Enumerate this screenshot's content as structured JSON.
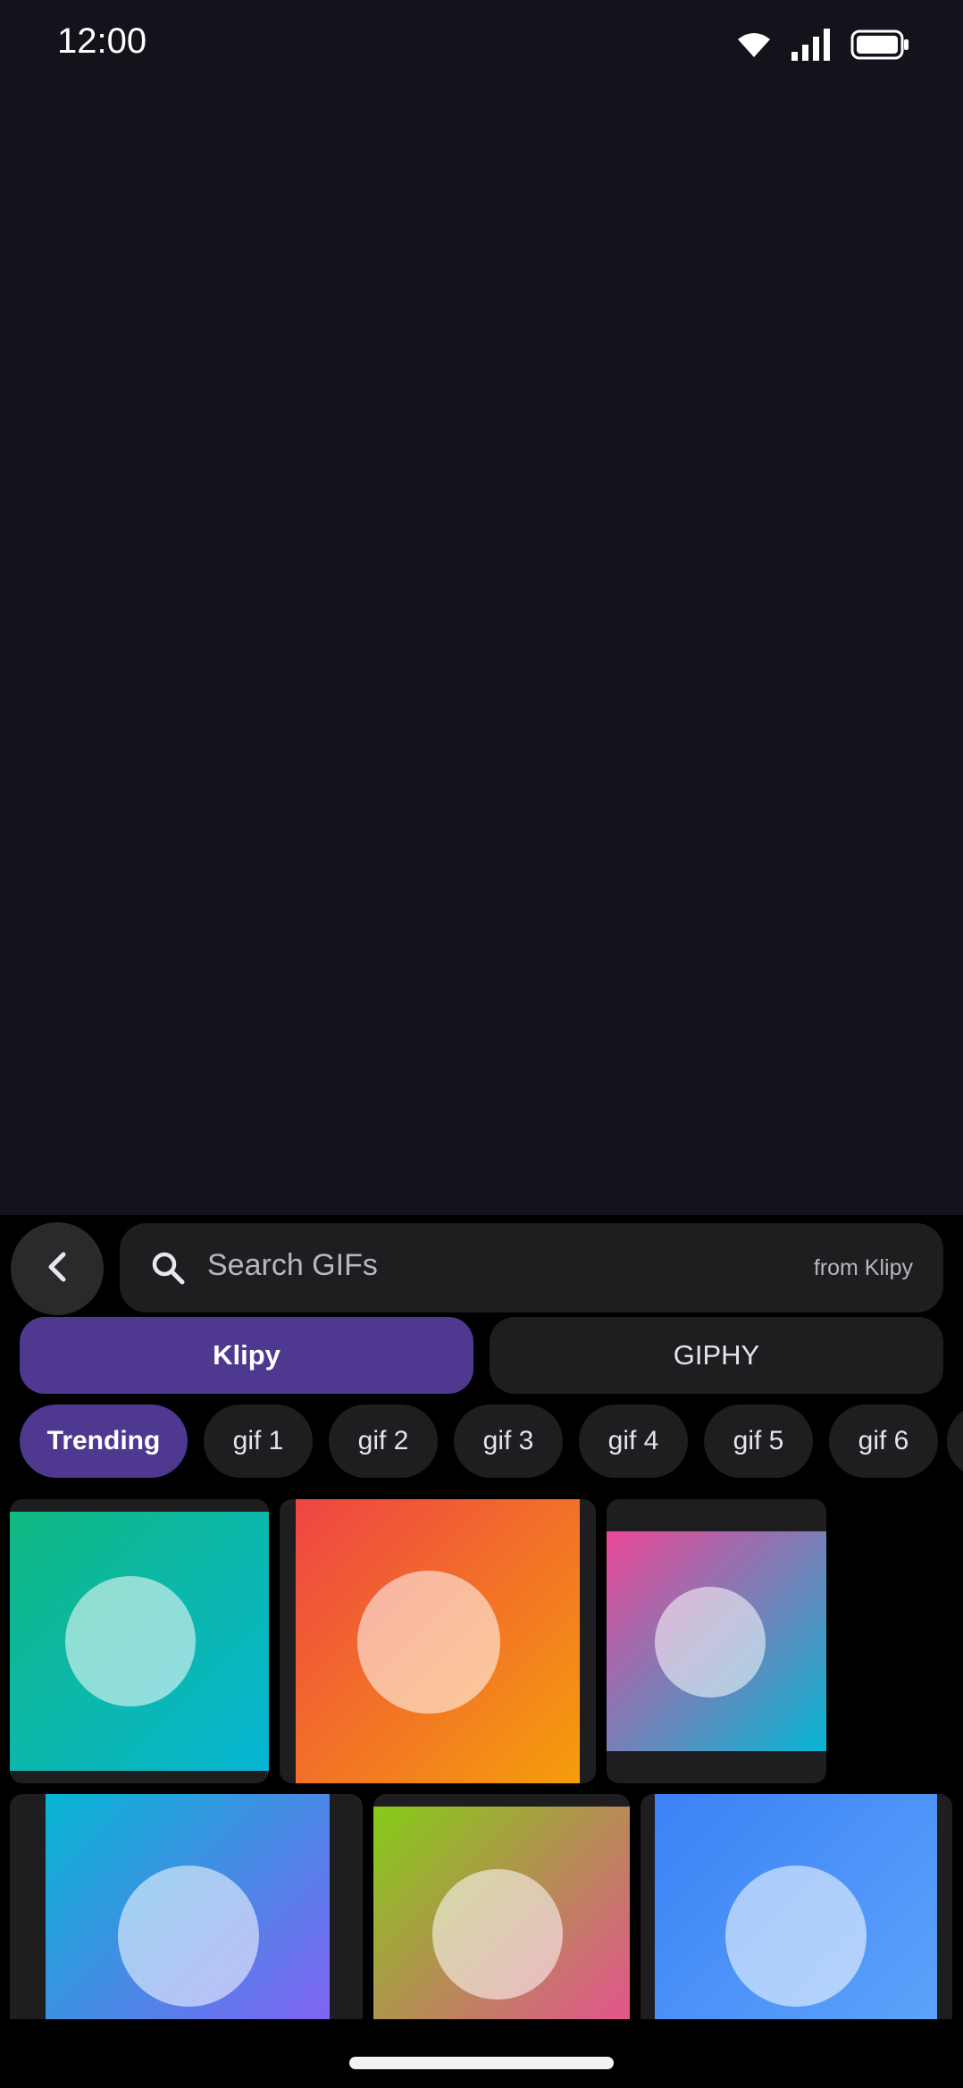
{
  "status_bar": {
    "time": "12:00",
    "icons": [
      "wifi-icon",
      "cellular-signal-icon",
      "battery-icon"
    ]
  },
  "search": {
    "back_icon": "chevron-left-icon",
    "search_icon": "search-icon",
    "placeholder": "Search GIFs",
    "source_label": "from Klipy"
  },
  "providers": [
    {
      "label": "Klipy",
      "selected": true
    },
    {
      "label": "GIPHY",
      "selected": false
    }
  ],
  "categories": [
    {
      "label": "Trending",
      "selected": true
    },
    {
      "label": "gif 1"
    },
    {
      "label": "gif 2"
    },
    {
      "label": "gif 3"
    },
    {
      "label": "gif 4"
    },
    {
      "label": "gif 5"
    },
    {
      "label": "gif 6"
    },
    {
      "label": ""
    }
  ],
  "colors": {
    "accent": "#4e3890",
    "background": "#14121a",
    "panel": "#000000",
    "surface": "#1e1e21"
  },
  "gifs": [
    {
      "gradient": [
        "#10b981",
        "#06b6d4"
      ]
    },
    {
      "gradient": [
        "#ef4444",
        "#f59e0b"
      ]
    },
    {
      "gradient": [
        "#ec4899",
        "#06b6d4"
      ]
    },
    {
      "gradient": [
        "#06b6d4",
        "#8b5cf6"
      ]
    },
    {
      "gradient": [
        "#84cc16",
        "#ec4899"
      ]
    },
    {
      "gradient": [
        "#3b82f6",
        "#60a5fa"
      ]
    }
  ]
}
